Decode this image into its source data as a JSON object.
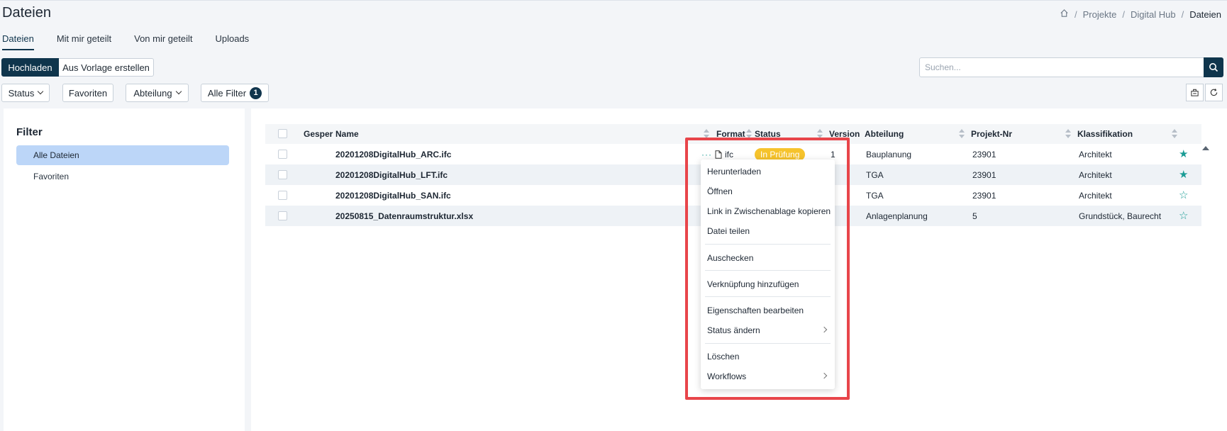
{
  "header": {
    "title": "Dateien",
    "breadcrumb": [
      "Projekte",
      "Digital Hub",
      "Dateien"
    ],
    "breadcrumb_sep": "/"
  },
  "tabs": [
    {
      "label": "Dateien",
      "active": true
    },
    {
      "label": "Mit mir geteilt",
      "active": false
    },
    {
      "label": "Von mir geteilt",
      "active": false
    },
    {
      "label": "Uploads",
      "active": false
    }
  ],
  "actions": {
    "upload_label": "Hochladen",
    "template_label": "Aus Vorlage erstellen"
  },
  "filters_bar": {
    "status_label": "Status",
    "favorites_label": "Favoriten",
    "department_label": "Abteilung",
    "all_filters_label": "Alle Filter",
    "all_filters_count": "1"
  },
  "search": {
    "placeholder": "Suchen..."
  },
  "filter_panel": {
    "title": "Filter",
    "items": [
      {
        "label": "Alle Dateien",
        "active": true
      },
      {
        "label": "Favoriten",
        "active": false
      }
    ]
  },
  "table": {
    "columns": {
      "locked": "Gesperrt",
      "name": "Name",
      "format": "Format",
      "status": "Status",
      "version": "Version",
      "department": "Abteilung",
      "project_no": "Projekt-Nr",
      "classification": "Klassifikation"
    },
    "rows": [
      {
        "name": "20201208DigitalHub_ARC.ifc",
        "format": "ifc",
        "status": "In Prüfung",
        "version": "1",
        "department": "Bauplanung",
        "project_no": "23901",
        "classification": "Architekt",
        "favorite": true
      },
      {
        "name": "20201208DigitalHub_LFT.ifc",
        "format": "",
        "status": "",
        "version": "",
        "department": "TGA",
        "project_no": "23901",
        "classification": "Architekt",
        "favorite": true
      },
      {
        "name": "20201208DigitalHub_SAN.ifc",
        "format": "",
        "status": "",
        "version": "",
        "department": "TGA",
        "project_no": "23901",
        "classification": "Architekt",
        "favorite": false
      },
      {
        "name": "20250815_Datenraumstruktur.xlsx",
        "format": "",
        "status": "",
        "version": "",
        "department": "Anlagenplanung",
        "project_no": "5",
        "classification": "Grundstück, Baurecht",
        "favorite": false
      }
    ],
    "row_menu_glyph": "···"
  },
  "context_menu": {
    "items": [
      "Herunterladen",
      "Öffnen",
      "Link in Zwischenablage kopieren",
      "Datei teilen",
      "Auschecken",
      "Verknüpfung hinzufügen",
      "Eigenschaften bearbeiten",
      "Status ändern",
      "Löschen",
      "Workflows"
    ]
  },
  "icons": {
    "home": "home-icon",
    "search": "search-icon",
    "export": "export-icon",
    "refresh": "refresh-icon",
    "file": "file-icon",
    "star": "star-icon"
  },
  "colors": {
    "primary": "#0f354c",
    "accent_teal": "#1a9c95",
    "status_review": "#f6c32c",
    "highlight": "#e8454a",
    "active_filter": "#bcd6f8"
  }
}
